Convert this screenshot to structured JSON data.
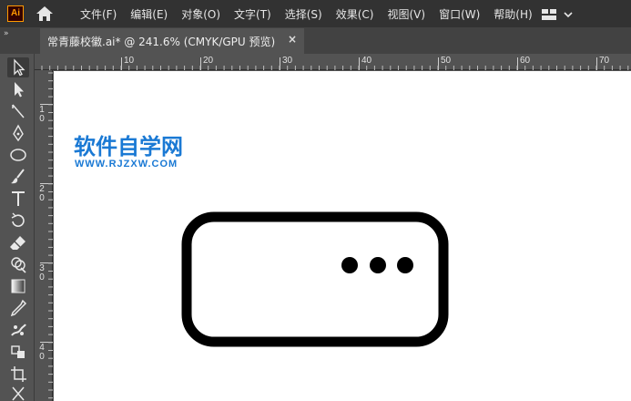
{
  "app": {
    "logo_text": "Ai",
    "menu": [
      "文件(F)",
      "编辑(E)",
      "对象(O)",
      "文字(T)",
      "选择(S)",
      "效果(C)",
      "视图(V)",
      "窗口(W)",
      "帮助(H)"
    ]
  },
  "tabs": {
    "collapse_glyph": "»",
    "document_title": "常青藤校徽.ai* @ 241.6% (CMYK/GPU 预览)",
    "close_glyph": "×"
  },
  "toolbar": {
    "tools": [
      "selection-tool",
      "direct-selection-tool",
      "line-tool",
      "pen-tool",
      "ellipse-tool",
      "paintbrush-tool",
      "type-tool",
      "rotate-tool",
      "eraser-tool",
      "shape-builder-tool",
      "gradient-tool",
      "eyedropper-tool",
      "puppet-warp-tool",
      "live-paint-tool",
      "artboard-tool",
      "scissors-tool"
    ]
  },
  "rulers": {
    "top": [
      "10",
      "20",
      "30",
      "40",
      "50",
      "60",
      "70"
    ],
    "left": [
      "1\n0",
      "2\n0",
      "3\n0",
      "4\n0"
    ]
  },
  "canvas": {
    "watermark_cn": "软件自学网",
    "watermark_en": "WWW.RJZXW.COM"
  }
}
